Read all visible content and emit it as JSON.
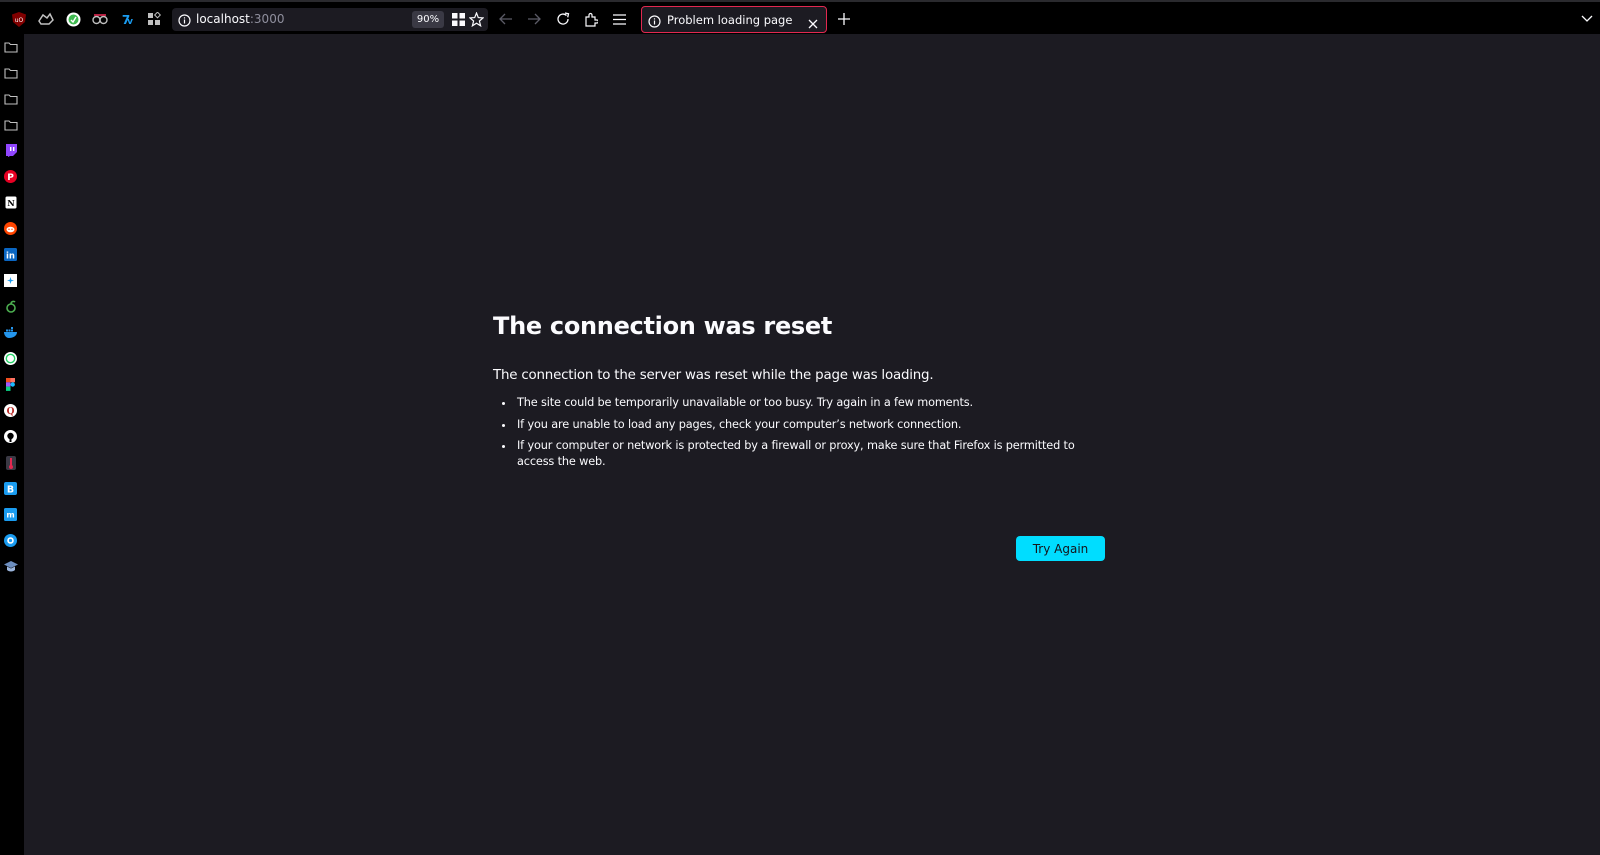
{
  "toolbar": {
    "extensions": [
      {
        "name": "ublock-origin-icon",
        "color": "#e22850"
      },
      {
        "name": "extension-icon-2",
        "color": "#c0c0c0"
      },
      {
        "name": "extension-icon-3",
        "color": "#3fb950"
      },
      {
        "name": "extension-icon-4",
        "color": "#c0c0c0"
      },
      {
        "name": "extension-icon-5",
        "color": "#1a9cf0"
      },
      {
        "name": "extensions-grid-icon",
        "color": "#c0c0c0"
      }
    ],
    "url_host": "localhost",
    "url_port": ":3000",
    "zoom": "90%"
  },
  "tab": {
    "title": "Problem loading page"
  },
  "sidebar": {
    "items": [
      {
        "icon": "folder-icon"
      },
      {
        "icon": "folder-icon"
      },
      {
        "icon": "folder-icon"
      },
      {
        "icon": "folder-icon"
      },
      {
        "icon": "twitch-icon",
        "color": "#9146ff"
      },
      {
        "icon": "pinterest-icon",
        "color": "#e60023"
      },
      {
        "icon": "notion-icon",
        "color": "#ffffff"
      },
      {
        "icon": "reddit-icon",
        "color": "#ff4500"
      },
      {
        "icon": "linkedin-icon",
        "color": "#0a66c2"
      },
      {
        "icon": "white-square-icon",
        "color": "#ffffff"
      },
      {
        "icon": "green-swirl-icon",
        "color": "#4caf50"
      },
      {
        "icon": "docker-icon",
        "color": "#2496ed"
      },
      {
        "icon": "whatsapp-icon",
        "color": "#25d366"
      },
      {
        "icon": "figma-icon",
        "color": "#f24e1e"
      },
      {
        "icon": "quora-icon",
        "color": "#b92b27"
      },
      {
        "icon": "github-icon",
        "color": "#ffffff"
      },
      {
        "icon": "thermometer-icon",
        "color": "#e22850"
      },
      {
        "icon": "bootstrap-icon",
        "color": "#1a9cf0"
      },
      {
        "icon": "medium-icon",
        "color": "#1a9cf0"
      },
      {
        "icon": "badge-icon",
        "color": "#1a9cf0"
      },
      {
        "icon": "graduation-cap-icon",
        "color": "#6c8ebf"
      }
    ]
  },
  "error": {
    "title": "The connection was reset",
    "description": "The connection to the server was reset while the page was loading.",
    "bullets": [
      "The site could be temporarily unavailable or too busy. Try again in a few moments.",
      "If you are unable to load any pages, check your computer’s network connection.",
      "If your computer or network is protected by a firewall or proxy, make sure that Firefox is permitted to access the web."
    ],
    "try_again": "Try Again"
  },
  "colors": {
    "accent": "#00ddff",
    "tab_border": "#e22850",
    "background": "#1c1b22"
  }
}
